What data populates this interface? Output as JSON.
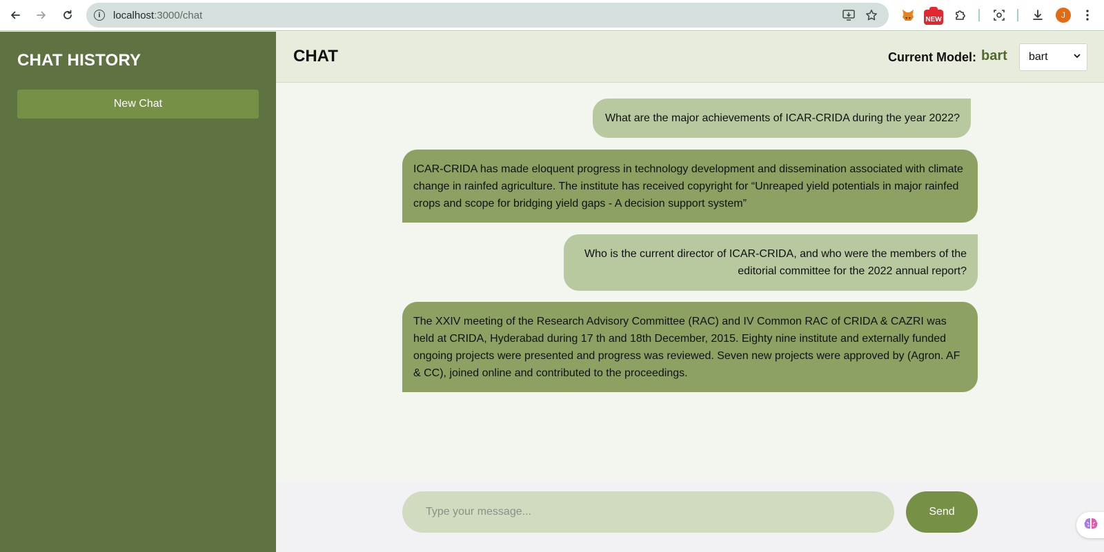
{
  "browser": {
    "url_host": "localhost",
    "url_path": ":3000/chat",
    "new_badge": "NEW",
    "avatar_initial": "J"
  },
  "sidebar": {
    "title": "CHAT HISTORY",
    "new_chat_label": "New Chat"
  },
  "header": {
    "title": "CHAT",
    "model_label": "Current Model:",
    "model_value": "bart",
    "model_select_value": "bart"
  },
  "messages": [
    {
      "role": "user",
      "text": "What are the major achievements of ICAR-CRIDA during the year 2022?"
    },
    {
      "role": "bot",
      "text": "ICAR-CRIDA has made eloquent progress in technology development and dissemination associated with climate change in rainfed agriculture. The institute has received copyright for “Unreaped yield potentials in major rainfed crops and scope for bridging yield gaps - A decision support system”"
    },
    {
      "role": "user",
      "text": "Who is the current director of ICAR-CRIDA, and who were the members of the editorial committee for the 2022 annual report?"
    },
    {
      "role": "bot",
      "text": "The XXIV meeting of the Research Advisory Committee (RAC) and IV Common RAC of CRIDA & CAZRI was held at CRIDA, Hyderabad during 17 th and 18th December, 2015. Eighty nine institute and externally funded ongoing projects were presented and progress was reviewed. Seven new projects were approved by (Agron. AF & CC), joined online and contributed to the proceedings."
    }
  ],
  "composer": {
    "placeholder": "Type your message...",
    "send_label": "Send"
  },
  "colors": {
    "sidebar_bg": "#5e7341",
    "button_green": "#769145",
    "user_bubble": "#b8c89f",
    "bot_bubble": "#8da262",
    "model_value": "#4f6b2c"
  }
}
